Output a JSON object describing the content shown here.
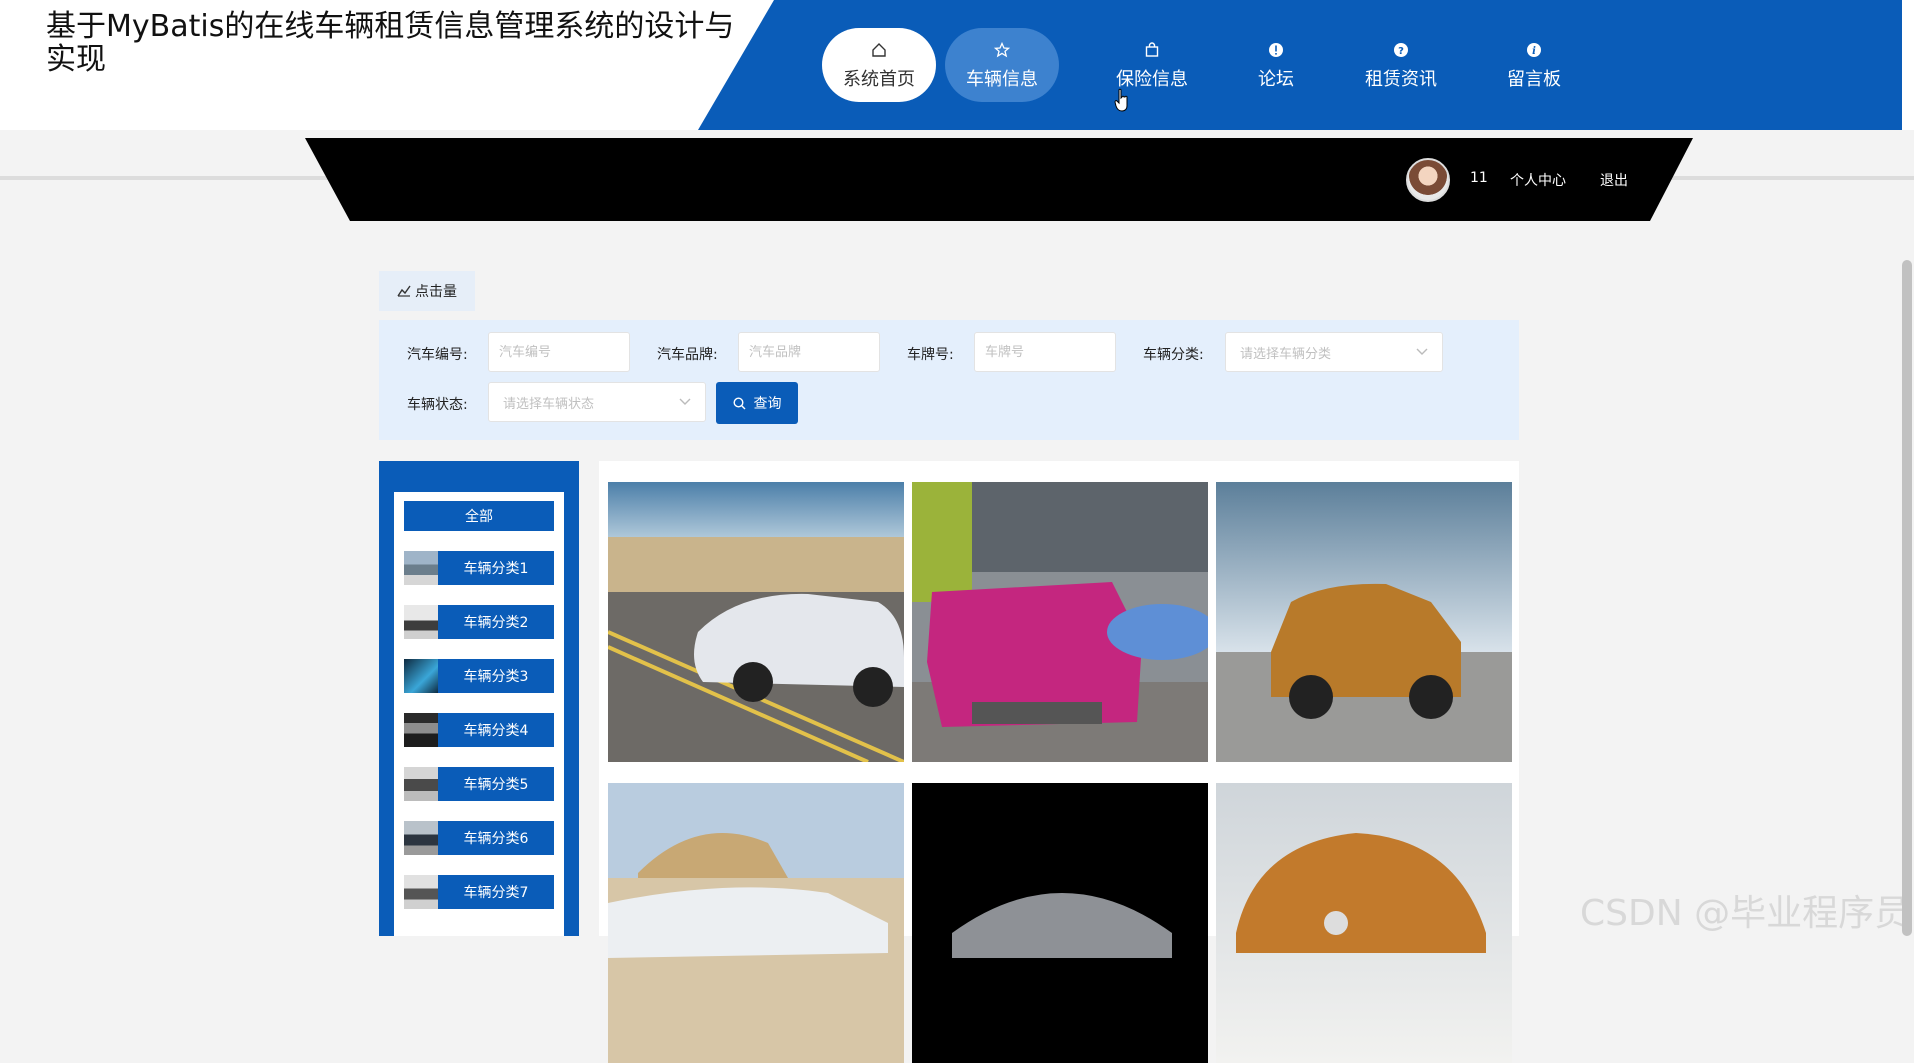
{
  "site": {
    "title": "基于MyBatis的在线车辆租赁信息管理系统的设计与实现"
  },
  "nav": {
    "items": [
      {
        "label": "系统首页",
        "icon": "home-icon"
      },
      {
        "label": "车辆信息",
        "icon": "star-icon"
      },
      {
        "label": "保险信息",
        "icon": "bag-icon"
      },
      {
        "label": "论坛",
        "icon": "info-icon"
      },
      {
        "label": "租赁资讯",
        "icon": "question-icon"
      },
      {
        "label": "留言板",
        "icon": "info-italic-icon"
      }
    ]
  },
  "user": {
    "name": "11",
    "center": "个人中心",
    "logout": "退出"
  },
  "tabs": {
    "clicks": "点击量"
  },
  "search": {
    "car_no_label": "汽车编号:",
    "car_no_placeholder": "汽车编号",
    "brand_label": "汽车品牌:",
    "brand_placeholder": "汽车品牌",
    "plate_label": "车牌号:",
    "plate_placeholder": "车牌号",
    "category_label": "车辆分类:",
    "category_placeholder": "请选择车辆分类",
    "status_label": "车辆状态:",
    "status_placeholder": "请选择车辆状态",
    "query_button": "查询"
  },
  "sidebar": {
    "all": "全部",
    "items": [
      "车辆分类1",
      "车辆分类2",
      "车辆分类3",
      "车辆分类4",
      "车辆分类5",
      "车辆分类6",
      "车辆分类7"
    ]
  },
  "colors": {
    "primary": "#0a5cb8",
    "nav_active": "#3d82cf",
    "search_bg": "#e4effc"
  },
  "watermark": "CSDN @毕业程序员"
}
